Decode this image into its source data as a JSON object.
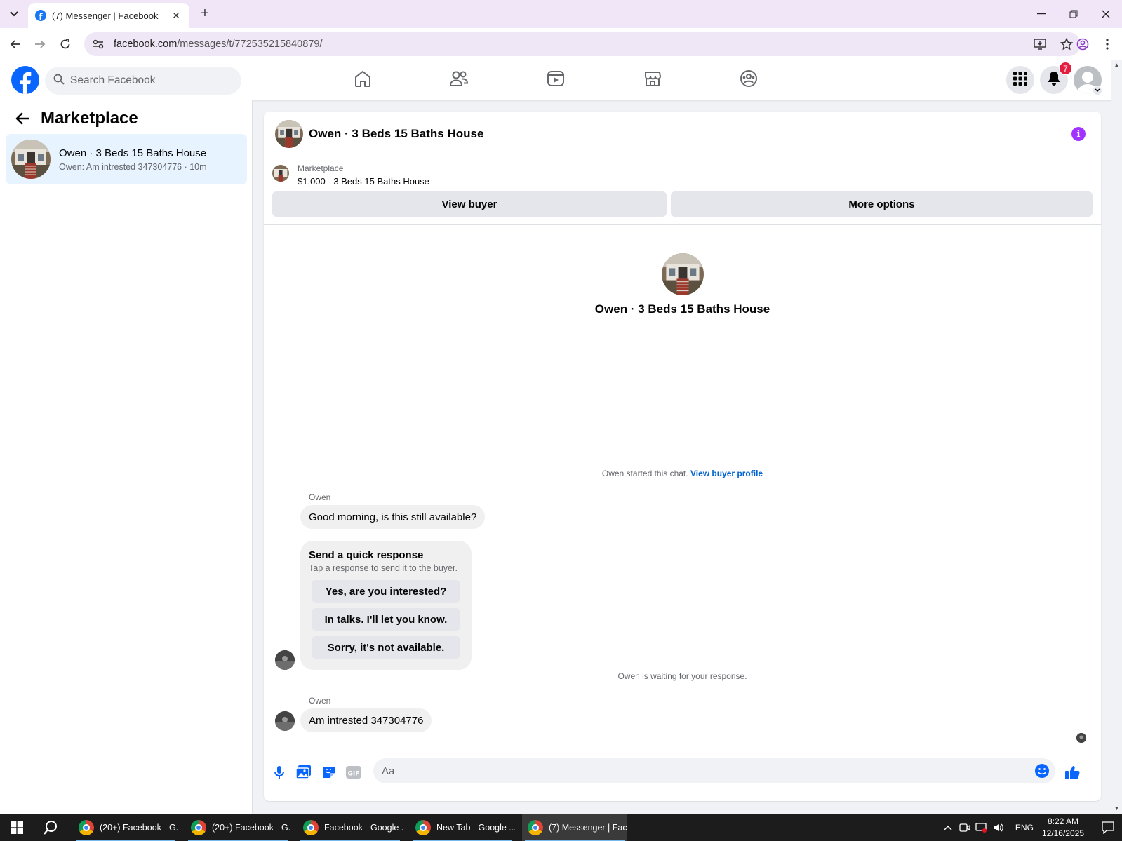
{
  "browser": {
    "tab_title": "(7) Messenger | Facebook",
    "url_host": "facebook.com",
    "url_path": "/messages/t/772535215840879/"
  },
  "fb_header": {
    "search_placeholder": "Search Facebook",
    "notification_count": "7"
  },
  "left_panel": {
    "title": "Marketplace",
    "conversation": {
      "name": "Owen · 3 Beds 15 Baths House",
      "preview": "Owen: Am intrested 347304776 · 10m"
    }
  },
  "chat": {
    "header_title": "Owen · 3 Beds 15 Baths House",
    "listing_kicker": "Marketplace",
    "listing_title": "$1,000 - 3 Beds 15 Baths House",
    "view_buyer_label": "View buyer",
    "more_options_label": "More options",
    "intro_name": "Owen · 3 Beds 15 Baths House",
    "started_text": "Owen started this chat.",
    "view_buyer_profile_link": "View buyer profile",
    "sender_name_1": "Owen",
    "message_1": "Good morning, is this still available?",
    "quick_title": "Send a quick response",
    "quick_sub": "Tap a response to send it to the buyer.",
    "quick_responses": [
      "Yes, are you interested?",
      "In talks. I'll let you know.",
      "Sorry, it's not available."
    ],
    "waiting_text": "Owen is waiting for your response.",
    "sender_name_2": "Owen",
    "message_2": "Am intrested  347304776",
    "composer_placeholder": "Aa"
  },
  "taskbar": {
    "items": [
      "(20+) Facebook - G...",
      "(20+) Facebook - G...",
      "Facebook - Google ...",
      "New Tab - Google ...",
      "(7) Messenger | Fac..."
    ],
    "language": "ENG",
    "time": "8:22 AM",
    "date": "12/16/2025"
  },
  "colors": {
    "facebook_blue": "#0866ff",
    "info_purple": "#a033ff",
    "link_blue": "#0064d1",
    "badge_red": "#e41e3f"
  }
}
